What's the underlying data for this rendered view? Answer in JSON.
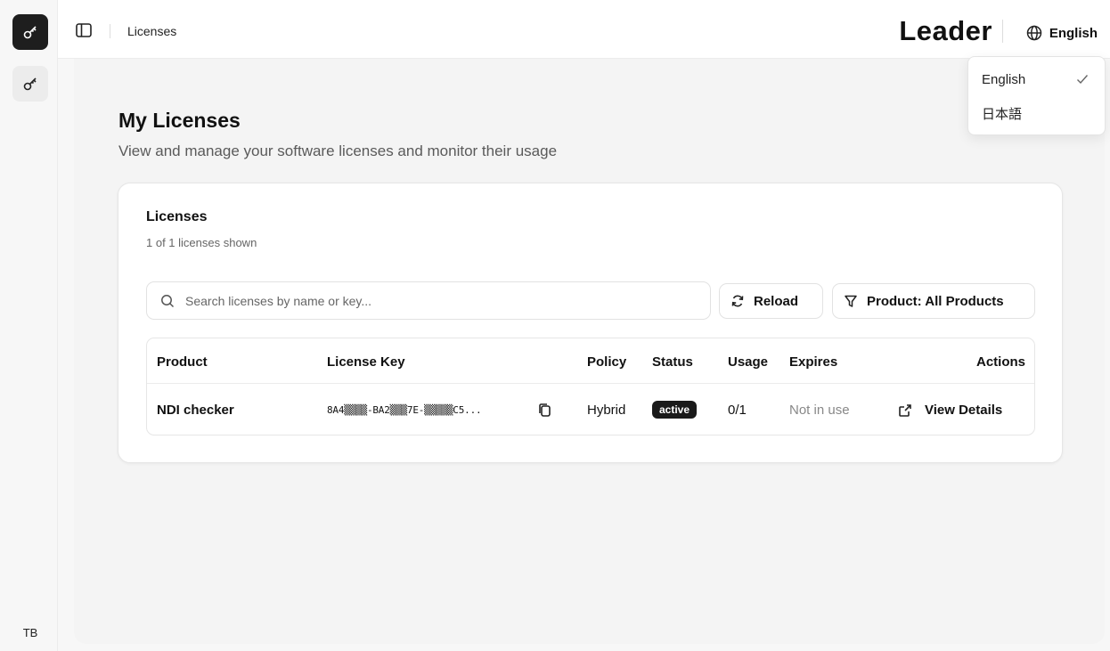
{
  "header": {
    "breadcrumb": "Licenses",
    "logo": "Leader",
    "language_button": "English"
  },
  "language_menu": {
    "options": [
      "English",
      "日本語"
    ],
    "selected": "English"
  },
  "sidebar": {
    "avatar_initials": "TB"
  },
  "page": {
    "title": "My Licenses",
    "subtitle": "View and manage your software licenses and monitor their usage"
  },
  "card": {
    "title": "Licenses",
    "subtitle": "1 of 1 licenses shown",
    "search_placeholder": "Search licenses by name or key...",
    "reload_label": "Reload",
    "filter_label": "Product: All Products"
  },
  "table": {
    "columns": [
      "Product",
      "License Key",
      "Policy",
      "Status",
      "Usage",
      "Expires",
      "Actions"
    ],
    "rows": [
      {
        "product": "NDI checker",
        "license_key": "8A4▒▒▒▒-BA2▒▒▒7E-▒▒▒▒▒C5...",
        "policy": "Hybrid",
        "status": "active",
        "usage": "0/1",
        "expires": "Not in use",
        "action": "View Details"
      }
    ]
  },
  "colors": {
    "accent": "#1a1a1a",
    "background": "#f4f4f4",
    "card": "#ffffff"
  },
  "icons": {
    "brand": "key-icon",
    "nav": "key-icon",
    "toggle": "sidebar-toggle-icon",
    "language": "globe-icon",
    "search": "search-icon",
    "reload": "refresh-icon",
    "filter": "filter-icon",
    "copy": "copy-icon",
    "external": "external-link-icon",
    "check": "check-icon"
  }
}
